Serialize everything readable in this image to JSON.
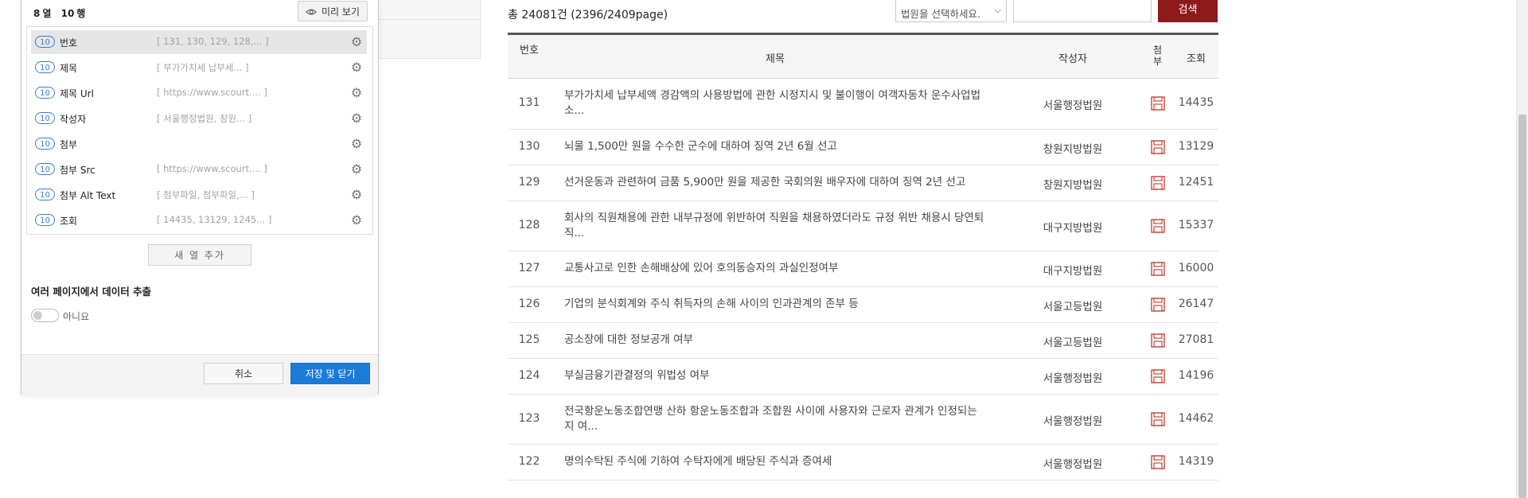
{
  "panel": {
    "cols_count": "8",
    "cols_label": "열",
    "rows_count": "10",
    "rows_label": "행",
    "preview_label": "미리 보기",
    "fields": [
      {
        "count": "10",
        "name": "번호",
        "sample": "[ 131, 130, 129, 128,... ]"
      },
      {
        "count": "10",
        "name": "제목",
        "sample": "[ 부가가치세 납부세... ]"
      },
      {
        "count": "10",
        "name": "제목 Url",
        "sample": "[ https://www.scourt.... ]"
      },
      {
        "count": "10",
        "name": "작성자",
        "sample": "[ 서울행정법원, 창원... ]"
      },
      {
        "count": "10",
        "name": "첨부",
        "sample": ""
      },
      {
        "count": "10",
        "name": "첨부 Src",
        "sample": "[ https://www.scourt.... ]"
      },
      {
        "count": "10",
        "name": "첨부 Alt Text",
        "sample": "[ 첨부파일, 첨부파일,... ]"
      },
      {
        "count": "10",
        "name": "조회",
        "sample": "[ 14435, 13129, 1245... ]"
      }
    ],
    "add_column_label": "새 열 추가",
    "multi_page_title": "여러 페이지에서 데이터 추출",
    "toggle_label": "아니요",
    "cancel_label": "취소",
    "save_label": "저장 및 닫기"
  },
  "board": {
    "total_text": "총 24081건 (2396/2409page)",
    "court_select_placeholder": "법원을 선택하세요.",
    "search_input_value": "",
    "search_button": "검색",
    "headers": {
      "num": "번호",
      "title": "제목",
      "writer": "작성자",
      "attach": "첨부",
      "views": "조회"
    },
    "rows": [
      {
        "num": "131",
        "title": "부가가치세 납부세액 경감액의 사용방법에 관한 시정지시 및 불이행이 여객자동차 운수사업법 소...",
        "writer": "서울행정법원",
        "views": "14435"
      },
      {
        "num": "130",
        "title": "뇌물 1,500만 원을 수수한 군수에 대하여 징역 2년 6월 선고",
        "writer": "창원지방법원",
        "views": "13129"
      },
      {
        "num": "129",
        "title": "선거운동과 관련하여 금품 5,900만 원을 제공한 국회의원 배우자에 대하여 징역 2년 선고",
        "writer": "창원지방법원",
        "views": "12451"
      },
      {
        "num": "128",
        "title": "회사의 직원채용에 관한 내부규정에 위반하여 직원을 채용하였더라도 규정 위반 채용시 당연퇴직...",
        "writer": "대구지방법원",
        "views": "15337"
      },
      {
        "num": "127",
        "title": "교통사고로 인한 손해배상에 있어 호의동승자의 과실인정여부",
        "writer": "대구지방법원",
        "views": "16000"
      },
      {
        "num": "126",
        "title": "기업의 분식회계와 주식 취득자의 손해 사이의 인과관계의 존부 등",
        "writer": "서울고등법원",
        "views": "26147"
      },
      {
        "num": "125",
        "title": "공소장에 대한 정보공개 여부",
        "writer": "서울고등법원",
        "views": "27081"
      },
      {
        "num": "124",
        "title": "부실금융기관결정의 위법성 여부",
        "writer": "서울행정법원",
        "views": "14196"
      },
      {
        "num": "123",
        "title": "전국항운노동조합연맹 산하 항운노동조합과 조합원 사이에 사용자와 근로자 관계가 인정되는지 여...",
        "writer": "서울행정법원",
        "views": "14462"
      },
      {
        "num": "122",
        "title": "명의수탁된 주식에 기하여 수탁자에게 배당된 주식과 증여세",
        "writer": "서울행정법원",
        "views": "14319"
      }
    ]
  },
  "colors": {
    "accent_blue": "#1a7bd9",
    "search_red": "#8e1a1a",
    "attach_icon_red": "#c0392b"
  }
}
